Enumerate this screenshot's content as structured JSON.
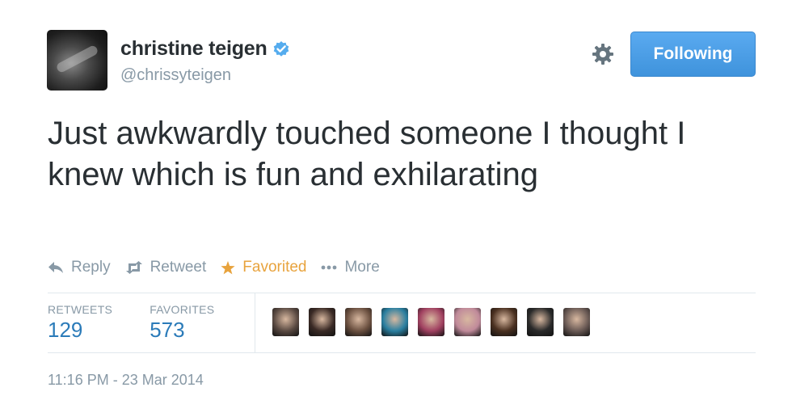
{
  "user": {
    "fullname": "christine teigen",
    "handle": "@chrissyteigen",
    "verified": true,
    "avatar_icon": "avatar-photo"
  },
  "header": {
    "settings_icon": "gear-icon",
    "follow_label": "Following"
  },
  "tweet": {
    "text": "Just awkwardly touched someone I thought I knew which is fun and exhilarating"
  },
  "actions": {
    "reply": "Reply",
    "retweet": "Retweet",
    "favorited": "Favorited",
    "more": "More"
  },
  "stats": {
    "retweets_label": "RETWEETS",
    "retweets_value": "129",
    "favorites_label": "FAVORITES",
    "favorites_value": "573"
  },
  "favoriters": [
    {
      "color": "#5a4a42"
    },
    {
      "color": "#3a2a25"
    },
    {
      "color": "#6b5040"
    },
    {
      "color": "#2a7fa0"
    },
    {
      "color": "#a04060"
    },
    {
      "color": "#c08a9a"
    },
    {
      "color": "#4a3020"
    },
    {
      "color": "#2a2a2a"
    },
    {
      "color": "#6a5a55"
    }
  ],
  "timestamp": "11:16 PM - 23 Mar 2014",
  "colors": {
    "accent": "#55acee",
    "link": "#2b7bb9",
    "favorite": "#e8a33d",
    "muted": "#8899a6"
  }
}
